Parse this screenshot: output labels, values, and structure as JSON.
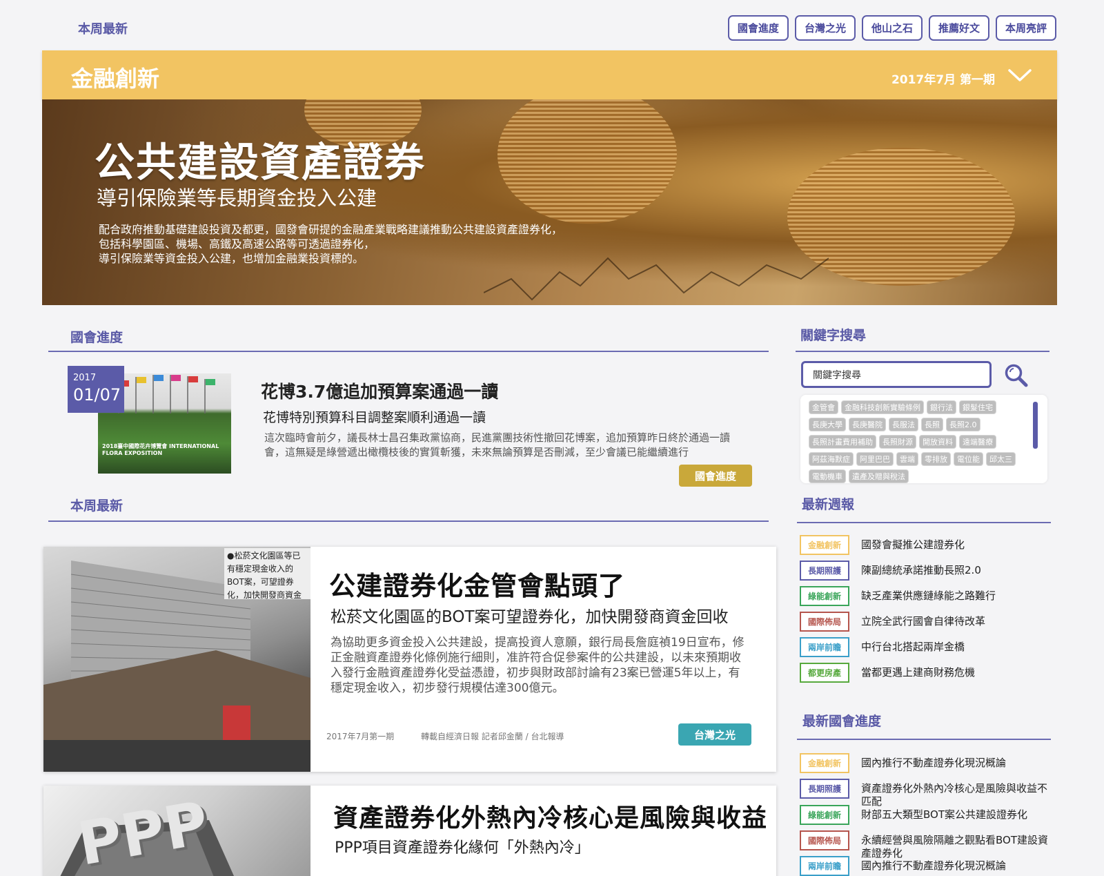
{
  "top": {
    "weekly_label": "本周最新",
    "nav": [
      "國會進度",
      "台灣之光",
      "他山之石",
      "推薦好文",
      "本周亮評"
    ]
  },
  "header": {
    "section": "金融創新",
    "issue": "2017年7月 第一期",
    "chevron_icon": "chevron-down-icon"
  },
  "hero": {
    "title": "公共建設資產證券",
    "subtitle": "導引保險業等長期資金投入公建",
    "desc": [
      "配合政府推動基礎建設投資及都更，國發會研提的金融產業戰略建議推動公共建設資產證券化，",
      "包括科學園區、機場、高鐵及高速公路等可透過證券化，",
      "導引保險業等資金投入公建，也增加金融業投資標的。"
    ]
  },
  "parliament": {
    "heading": "國會進度",
    "year": "2017",
    "date": "01/07",
    "title": "花博3.7億追加預算案通過一讀",
    "subtitle": "花博特別預算科目調整案順利通過一讀",
    "desc": "這次臨時會前夕，議長林士昌召集政黨協商，民進黨團技術性撤回花博案，追加預算昨日終於通過一讀會，這無疑是綠營遞出橄欖枝後的實質斬獲，未來無論預算是否刪減，至少會議已能繼續進行",
    "tag": "國會進度",
    "image_caption": "2018臺中國際花卉博覽會 INTERNATIONAL FLORA EXPOSITION"
  },
  "weekly": {
    "heading": "本周最新",
    "articles": [
      {
        "title": "公建證券化金管會點頭了",
        "subtitle": "松菸文化園區的BOT案可望證券化，加快開發商資金回收",
        "desc": "為協助更多資金投入公共建設，提高投資人意願，銀行局長詹庭禎19日宣布，修正金融資產證券化條例施行細則，准許符合促參案件的公共建設，以未來預期收入發行金融資產證券化受益憑證，初步與財政部討論有23案已營運5年以上，有穩定現金收入，初步發行規模估達300億元。",
        "issue": "2017年7月第一期",
        "source": "轉載自經濟日報 記者邱金蘭 / 台北報導",
        "tag": "台灣之光",
        "image_caption": "●松菸文化園區等已有穩定現金收入的BOT案，可望證券化，加快開發商資金回收。圖／本報資料照片"
      },
      {
        "title": "資產證券化外熱內冷核心是風險與收益",
        "subtitle": "PPP項目資產證券化緣何「外熱內冷」",
        "image_caption": "PPP"
      }
    ]
  },
  "sidebar": {
    "keyword_heading": "關鍵字搜尋",
    "search_value": "關鍵字搜尋",
    "search_icon": "search-icon",
    "tags": [
      "金管會",
      "金融科技創新實驗條例",
      "銀行法",
      "銀髮住宅",
      "長庚大學",
      "長庚醫院",
      "長服法",
      "長照",
      "長照2.0",
      "長照計畫費用補助",
      "長照財源",
      "開放資料",
      "遠端醫療",
      "阿茲海默症",
      "阿里巴巴",
      "雲端",
      "零排放",
      "電位能",
      "邱太三",
      "電動機車",
      "遺產及贈與稅法"
    ],
    "weekly_heading": "最新週報",
    "weekly_items": [
      {
        "tag": "金融創新",
        "color": "#f2c462",
        "text": "國發會擬推公建證券化"
      },
      {
        "tag": "長期照護",
        "color": "#5b5ba8",
        "text": "陳副總統承諾推動長照2.0"
      },
      {
        "tag": "綠能創新",
        "color": "#3aa55a",
        "text": "缺乏產業供應鏈綠能之路難行"
      },
      {
        "tag": "國際佈局",
        "color": "#b5554d",
        "text": "立院全武行國會自律待改革"
      },
      {
        "tag": "兩岸前瞻",
        "color": "#3a9fc9",
        "text": "中行台北搭起兩岸金橋"
      },
      {
        "tag": "都更房產",
        "color": "#57a93d",
        "text": "當都更遇上建商財務危機"
      }
    ],
    "parliament_heading": "最新國會進度",
    "parliament_items": [
      {
        "tag": "金融創新",
        "color": "#f2c462",
        "text": "國內推行不動產證券化現況概論"
      },
      {
        "tag": "長期照護",
        "color": "#5b5ba8",
        "text": "資產證券化外熱內冷核心是風險與收益不匹配"
      },
      {
        "tag": "綠能創新",
        "color": "#3aa55a",
        "text": "財部五大類型BOT案公共建設證券化"
      },
      {
        "tag": "國際佈局",
        "color": "#b5554d",
        "text": "永續經營與風險隔離之觀點看BOT建設資產證券化"
      },
      {
        "tag": "兩岸前瞻",
        "color": "#3a9fc9",
        "text": "國內推行不動產證券化現況概論"
      }
    ]
  },
  "colors": {
    "accent": "#5b5ba8",
    "gold": "#f2c462",
    "tag_gold": "#c9a83a",
    "tag_teal": "#3aa6b2"
  }
}
